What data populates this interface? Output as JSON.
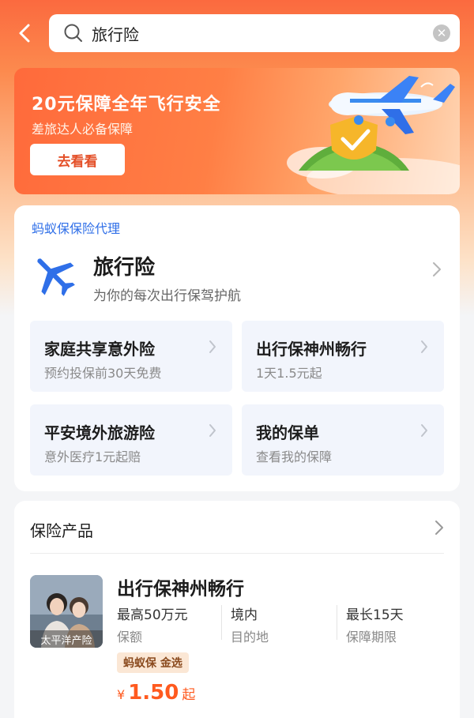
{
  "header": {
    "search_value": "旅行险",
    "clear_symbol": "✕"
  },
  "banner": {
    "title": "20元保障全年飞行安全",
    "subtitle": "差旅达人必备保障",
    "button_label": "去看看"
  },
  "travel": {
    "agent_label": "蚂蚁保保险代理",
    "title": "旅行险",
    "subtitle": "为你的每次出行保驾护航",
    "tiles": [
      {
        "title": "家庭共享意外险",
        "sub": "预约投保前30天免费"
      },
      {
        "title": "出行保神州畅行",
        "sub": "1天1.5元起"
      },
      {
        "title": "平安境外旅游险",
        "sub": "意外医疗1元起赔"
      },
      {
        "title": "我的保单",
        "sub": "查看我的保障"
      }
    ]
  },
  "products": {
    "header": "保险产品",
    "item": {
      "image_tag": "太平洋产险",
      "name": "出行保神州畅行",
      "stats": [
        {
          "value": "最高50万元",
          "label": "保额"
        },
        {
          "value": "境内",
          "label": "目的地"
        },
        {
          "value": "最长15天",
          "label": "保障期限"
        }
      ],
      "badge": "蚂蚁保 金选",
      "price_currency": "¥",
      "price_amount": "1.50",
      "price_unit": "起"
    }
  },
  "colors": {
    "accent": "#ff5a1f",
    "link_blue": "#2f6fe8",
    "tile_bg": "#f2f5fc"
  }
}
